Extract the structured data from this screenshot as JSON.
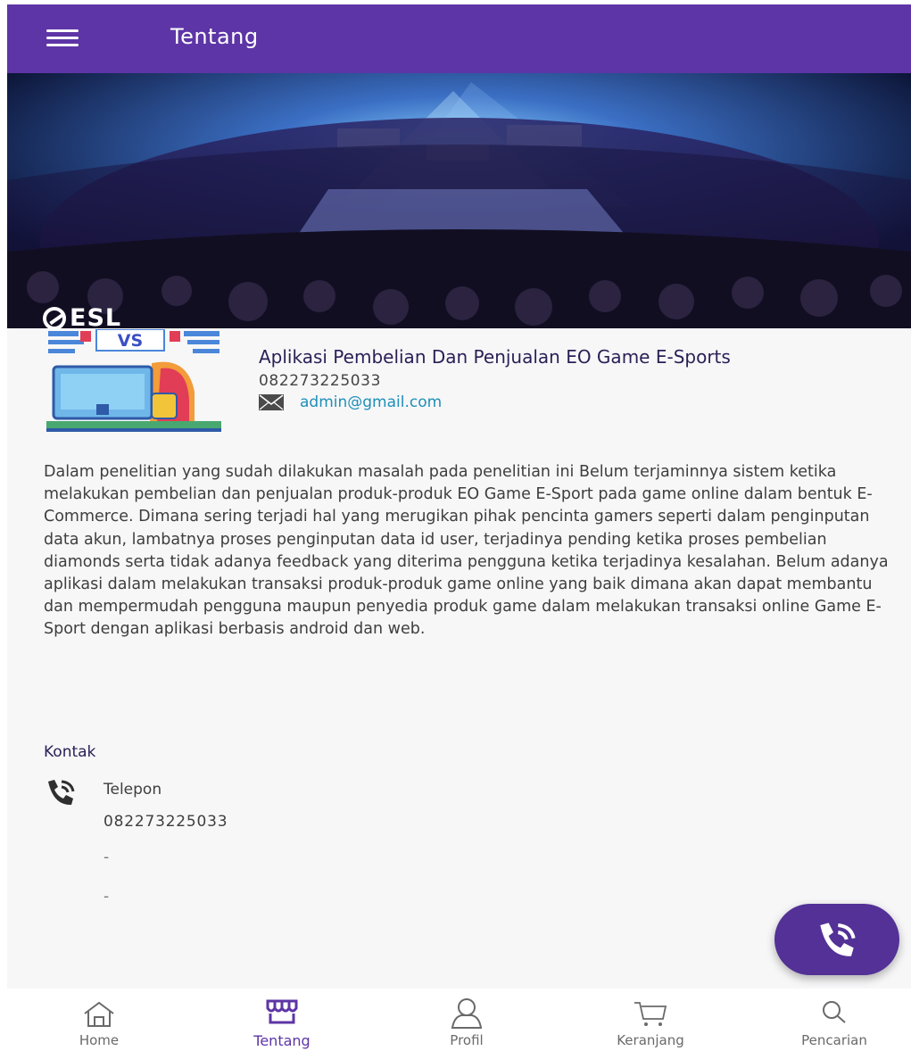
{
  "appbar": {
    "title": "Tentang",
    "menu_icon": "menu-icon"
  },
  "hero": {
    "badge_text": "ESL"
  },
  "profile": {
    "logo_text": "VS",
    "app_name": "Aplikasi Pembelian Dan Penjualan EO Game E-Sports",
    "phone": "082273225033",
    "email": "admin@gmail.com"
  },
  "description": "Dalam penelitian yang sudah dilakukan masalah pada penelitian ini Belum terjaminnya sistem ketika melakukan pembelian dan penjualan produk-produk EO Game E-Sport pada game online dalam bentuk E-Commerce. Dimana sering terjadi hal yang merugikan pihak pencinta gamers seperti dalam penginputan data akun, lambatnya proses penginputan data id user, terjadinya pending ketika proses pembelian diamonds serta tidak adanya feedback yang diterima pengguna ketika terjadinya kesalahan. Belum adanya aplikasi dalam melakukan transaksi produk-produk game online yang baik dimana akan dapat membantu dan mempermudah pengguna maupun penyedia produk game dalam melakukan transaksi online Game E-Sport dengan aplikasi berbasis android dan web.",
  "contact": {
    "title": "Kontak",
    "phone_label": "Telepon",
    "phone_number": "082273225033",
    "line2": "-",
    "line3": "-"
  },
  "bottom_nav": [
    {
      "label": "Home",
      "icon": "home-icon",
      "active": false
    },
    {
      "label": "Tentang",
      "icon": "store-icon",
      "active": true
    },
    {
      "label": "Profil",
      "icon": "user-icon",
      "active": false
    },
    {
      "label": "Keranjang",
      "icon": "cart-icon",
      "active": false
    },
    {
      "label": "Pencarian",
      "icon": "search-icon",
      "active": false
    }
  ],
  "colors": {
    "primary": "#5d35a6",
    "fab": "#533196",
    "link": "#1e8fb8",
    "background": "#f7f7f8"
  }
}
